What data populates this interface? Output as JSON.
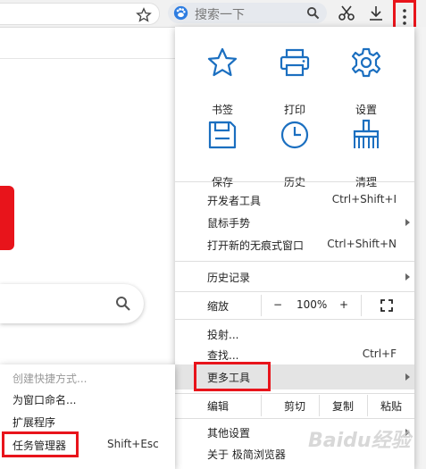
{
  "toolbar": {
    "search_placeholder": "搜索一下",
    "icons": [
      "star-icon",
      "baidu-icon",
      "search-icon",
      "scissors-icon",
      "download-icon",
      "menu-dots-icon"
    ]
  },
  "menu": {
    "tiles": [
      {
        "label": "书签",
        "icon": "star-icon"
      },
      {
        "label": "打印",
        "icon": "printer-icon"
      },
      {
        "label": "设置",
        "icon": "gear-icon"
      },
      {
        "label": "保存",
        "icon": "save-icon"
      },
      {
        "label": "历史",
        "icon": "clock-icon"
      },
      {
        "label": "清理",
        "icon": "broom-icon"
      }
    ],
    "items": {
      "devtools": {
        "label": "开发者工具",
        "shortcut": "Ctrl+Shift+I"
      },
      "gestures": {
        "label": "鼠标手势"
      },
      "incognito": {
        "label": "打开新的无痕式窗口",
        "shortcut": "Ctrl+Shift+N"
      },
      "history": {
        "label": "历史记录"
      },
      "cast": {
        "label": "投射..."
      },
      "find": {
        "label": "查找...",
        "shortcut": "Ctrl+F"
      },
      "more_tools": {
        "label": "更多工具"
      },
      "other_settings": {
        "label": "其他设置"
      },
      "about": {
        "label": "关于 极简浏览器"
      }
    },
    "zoom": {
      "label": "缩放",
      "minus": "−",
      "value": "100%",
      "plus": "+"
    },
    "edit": {
      "label": "编辑",
      "cut": "剪切",
      "copy": "复制",
      "paste": "粘贴"
    }
  },
  "submenu": {
    "items": [
      {
        "label": "创建快捷方式...",
        "disabled": true
      },
      {
        "label": "为窗口命名..."
      },
      {
        "label": "扩展程序"
      },
      {
        "label": "任务管理器",
        "shortcut": "Shift+Esc"
      }
    ]
  },
  "watermark": "Baidu经验",
  "colors": {
    "accent_blue": "#1b6fc0",
    "highlight_red": "#e8141b"
  }
}
